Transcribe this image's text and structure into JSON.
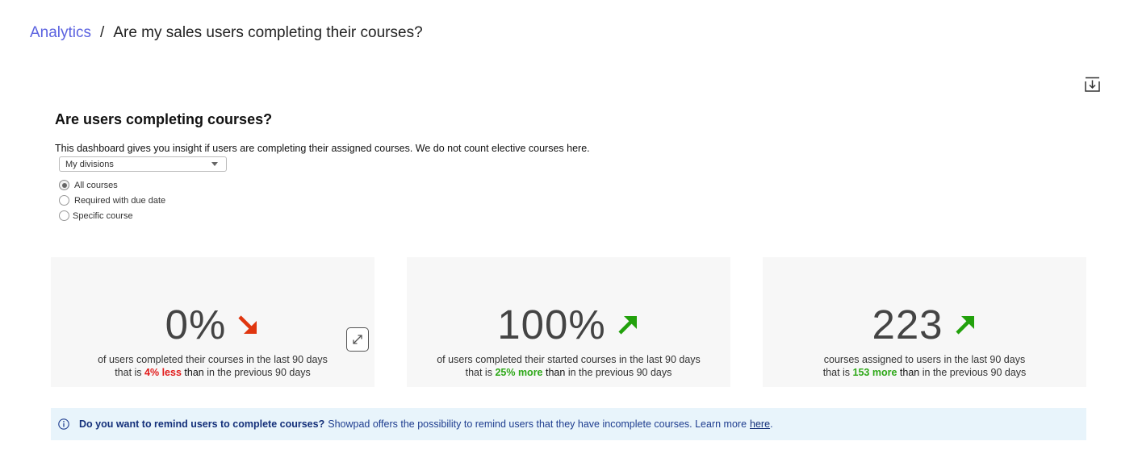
{
  "breadcrumb": {
    "root": "Analytics",
    "separator": "/",
    "current": "Are my sales users completing their courses?"
  },
  "page": {
    "heading": "Are users completing courses?",
    "description": "This dashboard gives you insight if users are completing their assigned courses. We do not count elective courses here."
  },
  "filters": {
    "division_select": {
      "value": "My divisions"
    },
    "course_type": {
      "options": [
        "All courses",
        "Required with due date",
        "Specific course"
      ],
      "selected": "All courses"
    }
  },
  "kpis": [
    {
      "value": "0%",
      "trend": "down",
      "trend_color": "#e0360f",
      "line1": "of users completed their courses in the last 90 days",
      "prefix": "that is",
      "delta": "4% less",
      "than": "than",
      "suffix": "in the previous 90 days"
    },
    {
      "value": "100%",
      "trend": "up",
      "trend_color": "#22a10c",
      "line1": "of users completed their started courses in the last 90 days",
      "prefix": "that is",
      "delta": "25% more",
      "than": "than",
      "suffix": "in the previous 90 days"
    },
    {
      "value": "223",
      "trend": "up",
      "trend_color": "#22a10c",
      "line1": "courses assigned to users in the last 90 days",
      "prefix": "that is",
      "delta": "153 more",
      "than": "than",
      "suffix": "in the previous 90 days"
    }
  ],
  "info_bar": {
    "bold": "Do you want to remind users to complete courses?",
    "text": "Showpad offers the possibility to remind users that they have incomplete courses. Learn more",
    "link": "here",
    "end": "."
  },
  "icons": {
    "download": "download-icon",
    "expand": "expand-icon",
    "info": "info-icon",
    "trend_down": "arrow-down-right-icon",
    "trend_up": "arrow-up-right-icon"
  },
  "colors": {
    "link": "#5c63e0",
    "negative": "#e21b1b",
    "positive": "#2ea818",
    "info_bg": "#e8f4fb"
  }
}
